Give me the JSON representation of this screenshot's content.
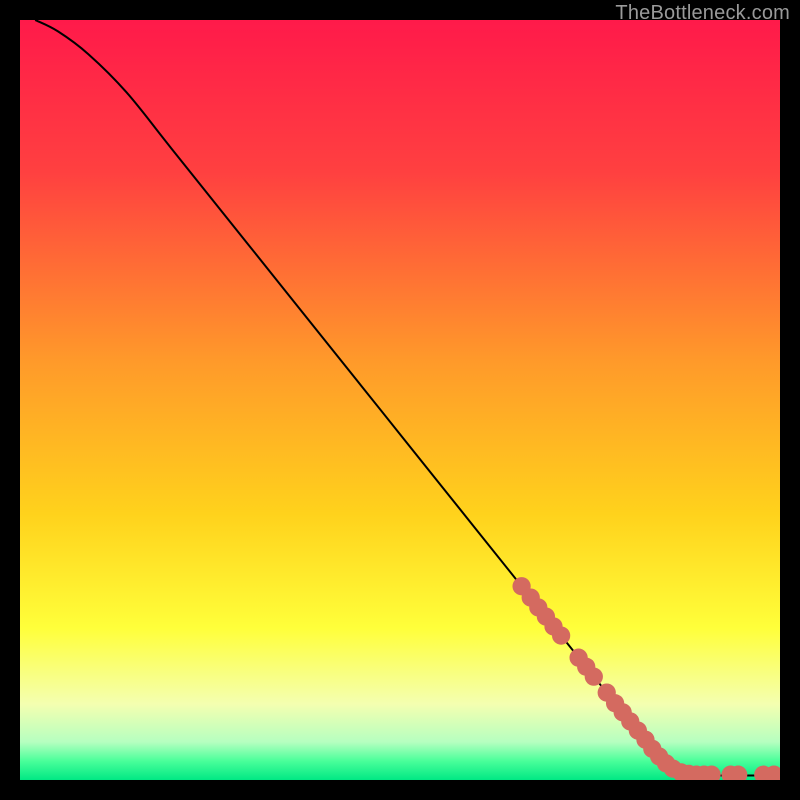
{
  "watermark": "TheBottleneck.com",
  "chart_data": {
    "type": "line",
    "title": "",
    "xlabel": "",
    "ylabel": "",
    "xlim": [
      0,
      100
    ],
    "ylim": [
      0,
      100
    ],
    "grid": false,
    "legend": false,
    "background_gradient": {
      "stops": [
        {
          "pos": 0.0,
          "color": "#ff1a4a"
        },
        {
          "pos": 0.2,
          "color": "#ff4040"
        },
        {
          "pos": 0.45,
          "color": "#ff9a2a"
        },
        {
          "pos": 0.65,
          "color": "#ffd21c"
        },
        {
          "pos": 0.8,
          "color": "#ffff3a"
        },
        {
          "pos": 0.9,
          "color": "#f4ffb0"
        },
        {
          "pos": 0.95,
          "color": "#b6ffc0"
        },
        {
          "pos": 0.975,
          "color": "#4aff9a"
        },
        {
          "pos": 1.0,
          "color": "#00e884"
        }
      ]
    },
    "curve": {
      "description": "Main black curve: starts near top-left, steep slight convex bend then near-linear decline to lower-right, flattening along the bottom.",
      "points": [
        {
          "x": 2.0,
          "y": 100.0
        },
        {
          "x": 5.0,
          "y": 98.5
        },
        {
          "x": 9.0,
          "y": 95.5
        },
        {
          "x": 14.0,
          "y": 90.5
        },
        {
          "x": 20.0,
          "y": 83.0
        },
        {
          "x": 30.0,
          "y": 70.5
        },
        {
          "x": 40.0,
          "y": 58.0
        },
        {
          "x": 50.0,
          "y": 45.5
        },
        {
          "x": 60.0,
          "y": 33.0
        },
        {
          "x": 70.0,
          "y": 20.5
        },
        {
          "x": 78.0,
          "y": 10.5
        },
        {
          "x": 84.0,
          "y": 3.2
        },
        {
          "x": 86.0,
          "y": 1.5
        },
        {
          "x": 88.0,
          "y": 0.8
        },
        {
          "x": 92.0,
          "y": 0.6
        },
        {
          "x": 96.0,
          "y": 0.6
        },
        {
          "x": 100.0,
          "y": 0.6
        }
      ]
    },
    "markers": {
      "color": "#d46a60",
      "radius_frac": 0.012,
      "points": [
        {
          "x": 66.0,
          "y": 25.5
        },
        {
          "x": 67.2,
          "y": 24.0
        },
        {
          "x": 68.2,
          "y": 22.7
        },
        {
          "x": 69.2,
          "y": 21.5
        },
        {
          "x": 70.2,
          "y": 20.2
        },
        {
          "x": 71.2,
          "y": 19.0
        },
        {
          "x": 73.5,
          "y": 16.1
        },
        {
          "x": 74.5,
          "y": 14.9
        },
        {
          "x": 75.5,
          "y": 13.6
        },
        {
          "x": 77.2,
          "y": 11.5
        },
        {
          "x": 78.3,
          "y": 10.1
        },
        {
          "x": 79.3,
          "y": 8.9
        },
        {
          "x": 80.3,
          "y": 7.7
        },
        {
          "x": 81.3,
          "y": 6.5
        },
        {
          "x": 82.3,
          "y": 5.3
        },
        {
          "x": 83.2,
          "y": 4.1
        },
        {
          "x": 84.1,
          "y": 3.1
        },
        {
          "x": 85.0,
          "y": 2.2
        },
        {
          "x": 85.9,
          "y": 1.5
        },
        {
          "x": 87.0,
          "y": 1.0
        },
        {
          "x": 88.0,
          "y": 0.8
        },
        {
          "x": 89.0,
          "y": 0.7
        },
        {
          "x": 90.0,
          "y": 0.7
        },
        {
          "x": 91.0,
          "y": 0.7
        },
        {
          "x": 93.5,
          "y": 0.7
        },
        {
          "x": 94.5,
          "y": 0.7
        },
        {
          "x": 97.8,
          "y": 0.7
        },
        {
          "x": 99.2,
          "y": 0.7
        }
      ]
    }
  }
}
